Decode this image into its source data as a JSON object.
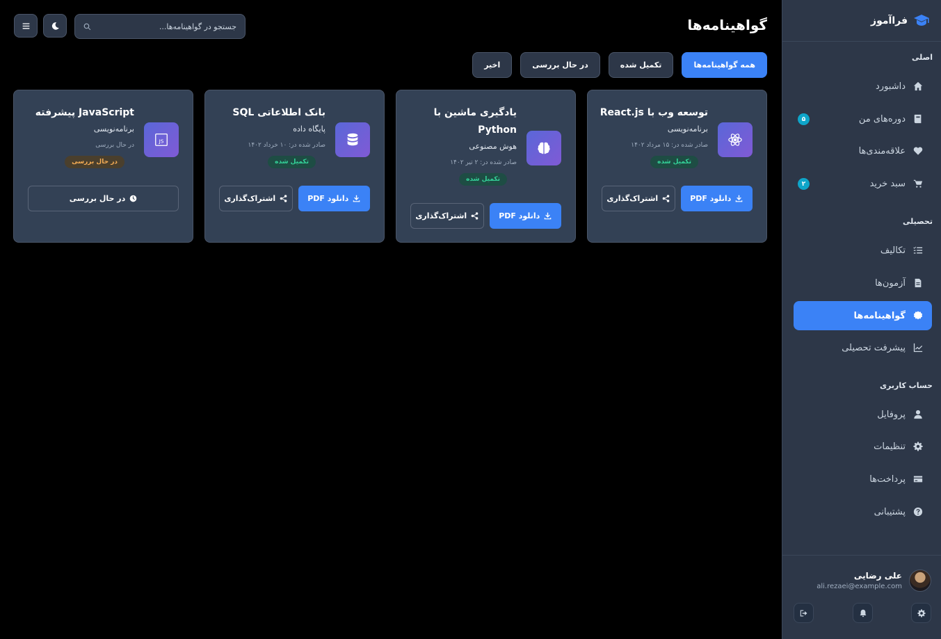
{
  "brand": {
    "name": "فراآموز"
  },
  "sidebar": {
    "sections": [
      {
        "title": "اصلی"
      },
      {
        "title": "تحصیلی"
      },
      {
        "title": "حساب کاربری"
      }
    ],
    "items": [
      {
        "label": "داشبورد",
        "icon": "home-icon"
      },
      {
        "label": "دوره‌های من",
        "icon": "book-icon",
        "badge": "۵"
      },
      {
        "label": "علاقه‌مندی‌ها",
        "icon": "heart-icon"
      },
      {
        "label": "سبد خرید",
        "icon": "cart-icon",
        "badge": "۲"
      },
      {
        "label": "تکالیف",
        "icon": "tasks-icon"
      },
      {
        "label": "آزمون‌ها",
        "icon": "file-icon"
      },
      {
        "label": "گواهینامه‌ها",
        "icon": "certificate-icon",
        "active": true
      },
      {
        "label": "پیشرفت تحصیلی",
        "icon": "chart-icon"
      },
      {
        "label": "پروفایل",
        "icon": "user-icon"
      },
      {
        "label": "تنظیمات",
        "icon": "gear-icon"
      },
      {
        "label": "پرداخت‌ها",
        "icon": "credit-card-icon"
      },
      {
        "label": "پشتیبانی",
        "icon": "help-icon"
      }
    ]
  },
  "user": {
    "name": "علی رضایی",
    "email": "ali.rezaei@example.com"
  },
  "header": {
    "title": "گواهینامه‌ها",
    "search_placeholder": "جستجو در گواهینامه‌ها..."
  },
  "tabs": [
    {
      "label": "همه گواهینامه‌ها",
      "active": true
    },
    {
      "label": "تکمیل شده"
    },
    {
      "label": "در حال بررسی"
    },
    {
      "label": "اخیر"
    }
  ],
  "cards": [
    {
      "title": "توسعه وب با React.js",
      "category": "برنامه‌نویسی",
      "date": "صادر شده در: ۱۵ مرداد ۱۴۰۲",
      "status": "تکمیل شده",
      "icon": "atom-icon",
      "pdf_label": "دانلود PDF",
      "share_label": "اشتراک‌گذاری"
    },
    {
      "title": "یادگیری ماشین با Python",
      "category": "هوش مصنوعی",
      "date": "صادر شده در: ۲ تیر ۱۴۰۲",
      "status": "تکمیل شده",
      "icon": "brain-icon",
      "pdf_label": "دانلود PDF",
      "share_label": "اشتراک‌گذاری"
    },
    {
      "title": "بانک اطلاعاتی SQL",
      "category": "پایگاه داده",
      "date": "صادر شده در: ۱۰ خرداد ۱۴۰۲",
      "status": "تکمیل شده",
      "icon": "database-icon",
      "pdf_label": "دانلود PDF",
      "share_label": "اشتراک‌گذاری"
    },
    {
      "title": "JavaScript پیشرفته",
      "category": "برنامه‌نویسی",
      "date": "در حال بررسی",
      "status": "در حال بررسی",
      "icon": "js-icon",
      "review_label": "در حال بررسی"
    }
  ],
  "colors": {
    "accent": "#3b82f6",
    "sidebar_bg": "#2d3748",
    "card_bg": "#334155",
    "success": "#34d399",
    "warning": "#f6ad55"
  }
}
